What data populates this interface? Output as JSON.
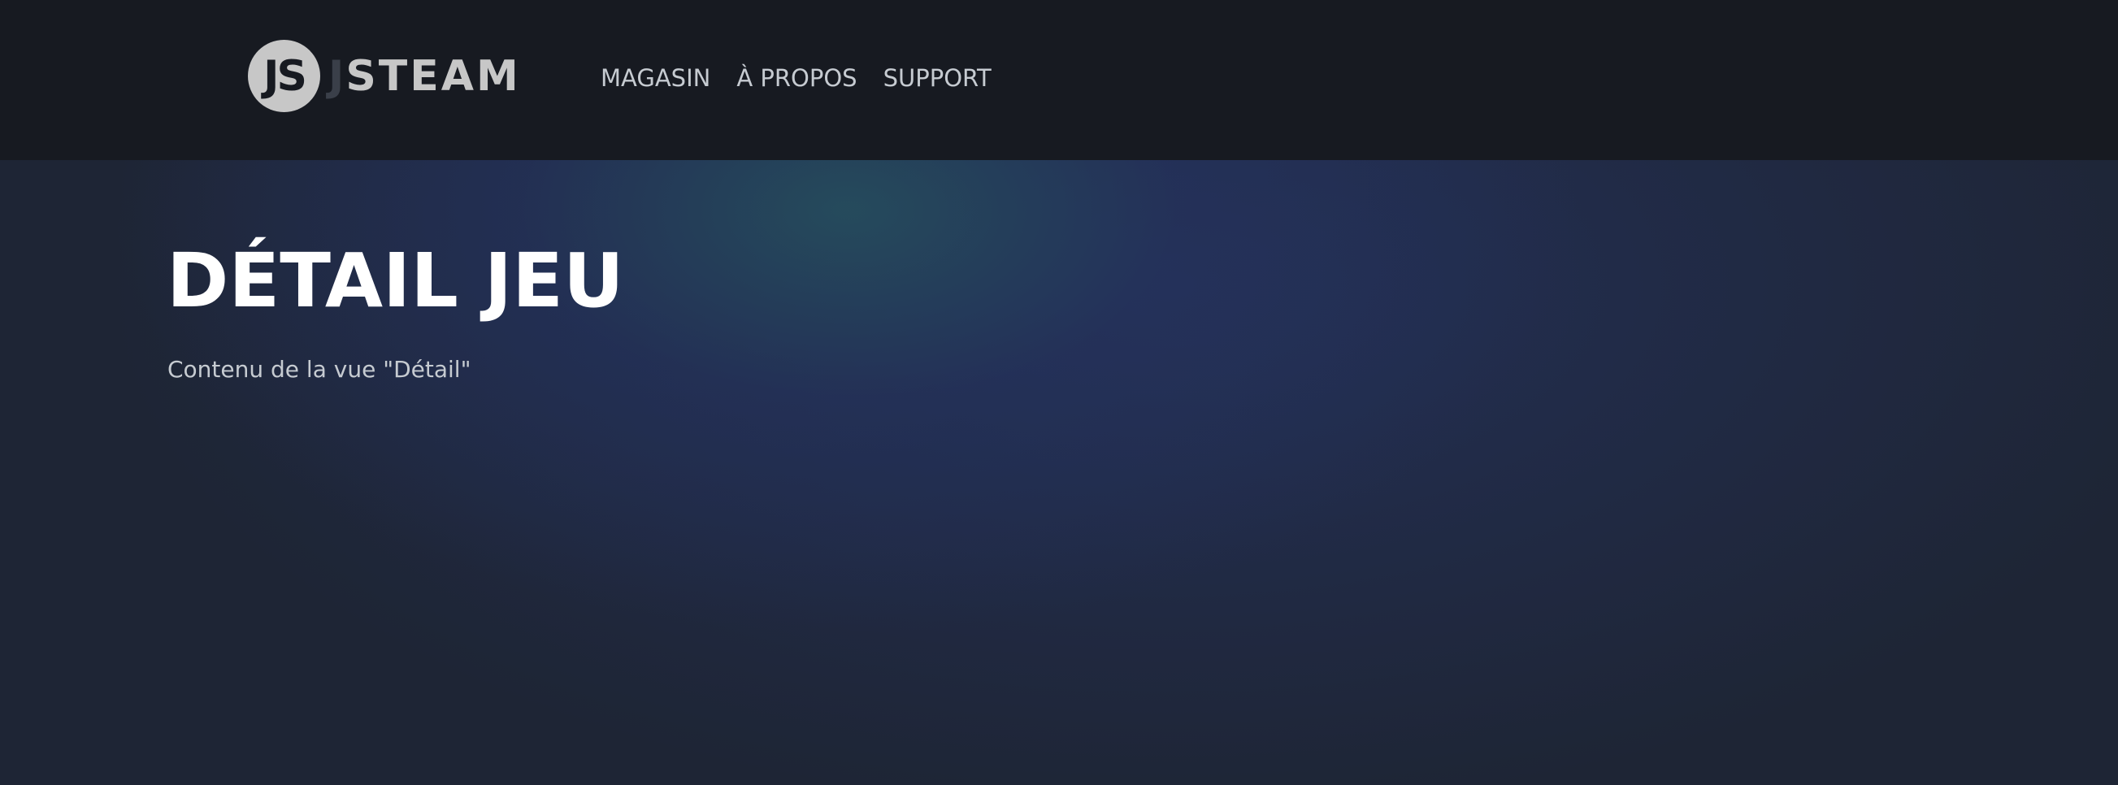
{
  "header": {
    "logo": {
      "circle_text": "JS",
      "faded_text": "J",
      "text": "STEAM"
    },
    "nav": [
      {
        "label": "MAGASIN"
      },
      {
        "label": "À PROPOS"
      },
      {
        "label": "SUPPORT"
      }
    ]
  },
  "main": {
    "title": "DÉTAIL JEU",
    "subtitle": "Contenu de la vue \"Détail\""
  },
  "colors": {
    "header_bg": "#171a21",
    "page_bg": "#1e2535",
    "nav_text": "#c6cbd1",
    "logo": "#c7c7c7",
    "title": "#ffffff"
  }
}
